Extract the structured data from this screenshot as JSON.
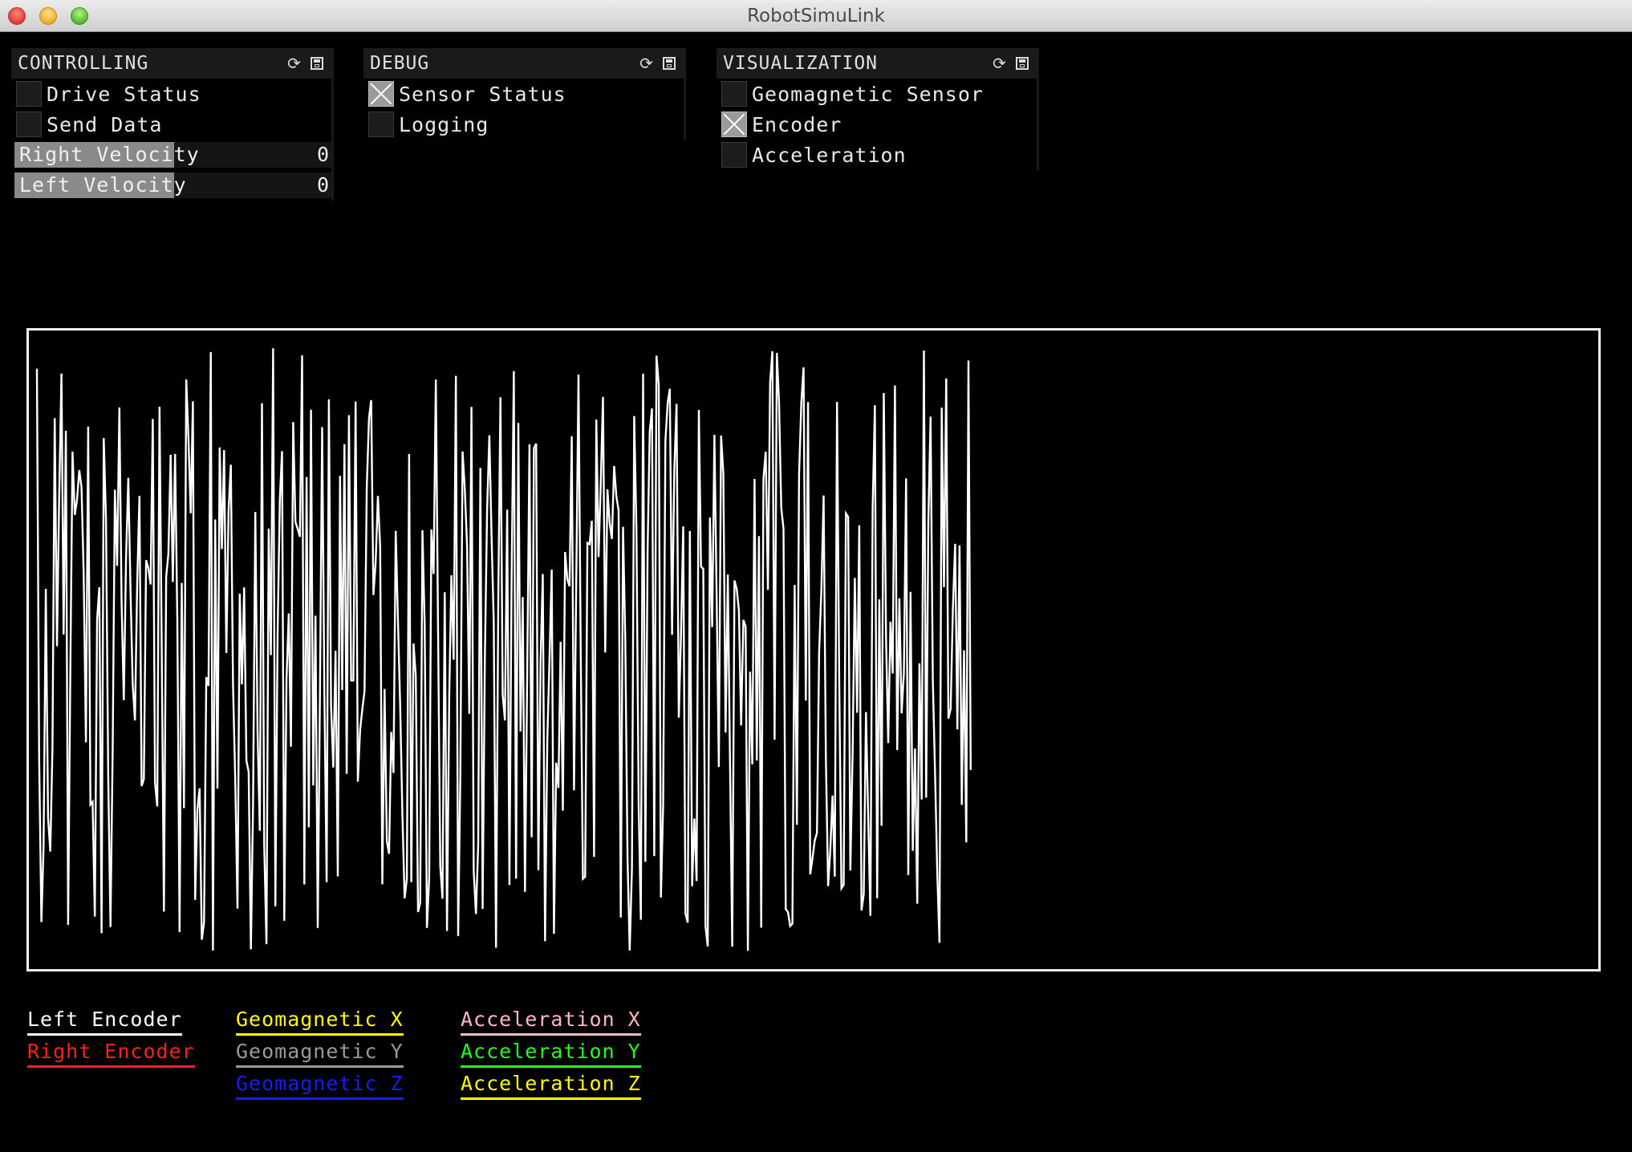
{
  "window": {
    "title": "RobotSimuLink"
  },
  "panels": {
    "controlling": {
      "title": "CONTROLLING",
      "toggles": [
        {
          "label": "Drive Status",
          "checked": false
        },
        {
          "label": "Send Data",
          "checked": false
        }
      ],
      "sliders": [
        {
          "label": "Right Velocity",
          "value": "0",
          "fill": 0.5
        },
        {
          "label": "Left Velocity",
          "value": "0",
          "fill": 0.5
        }
      ]
    },
    "debug": {
      "title": "DEBUG",
      "toggles": [
        {
          "label": "Sensor Status",
          "checked": true
        },
        {
          "label": "Logging",
          "checked": false
        }
      ]
    },
    "visualization": {
      "title": "VISUALIZATION",
      "toggles": [
        {
          "label": "Geomagnetic Sensor",
          "checked": false
        },
        {
          "label": "Encoder",
          "checked": true
        },
        {
          "label": "Acceleration",
          "checked": false
        }
      ]
    }
  },
  "icons": {
    "reload": "reload-icon",
    "save": "save-icon"
  },
  "legend": [
    {
      "label": "Left Encoder",
      "color": "#ffffff"
    },
    {
      "label": "Right Encoder",
      "color": "#ff2020"
    },
    {
      "label": "Geomagnetic X",
      "color": "#ffff00"
    },
    {
      "label": "Geomagnetic Y",
      "color": "#9a9a9a"
    },
    {
      "label": "Geomagnetic Z",
      "color": "#1a1aff"
    },
    {
      "label": "Acceleration X",
      "color": "#ffb6c8"
    },
    {
      "label": "Acceleration Y",
      "color": "#22ff22"
    },
    {
      "label": "Acceleration Z",
      "color": "#ffff00"
    }
  ],
  "plot": {
    "series_color": "#ffffff",
    "fill_fraction": 0.595,
    "samples": 420
  }
}
